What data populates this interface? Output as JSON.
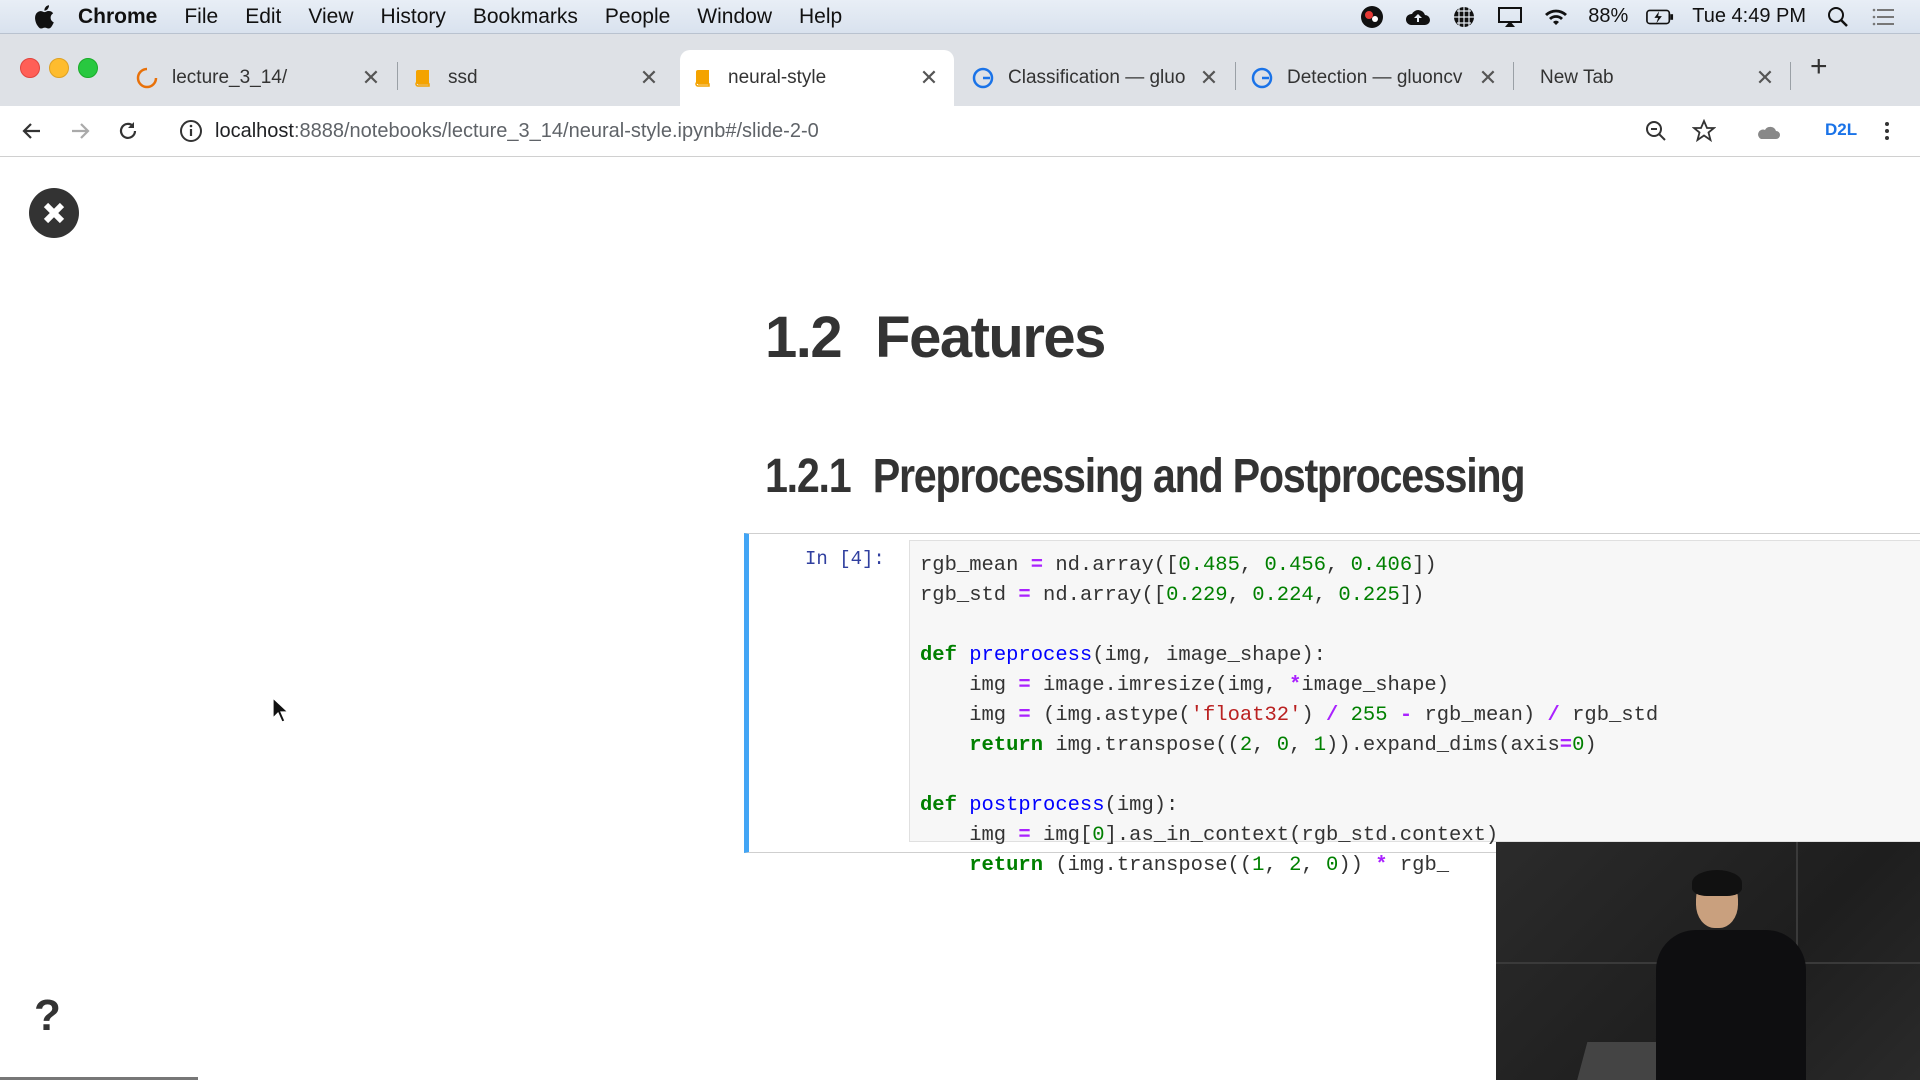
{
  "menubar": {
    "app_name": "Chrome",
    "items": [
      "File",
      "Edit",
      "View",
      "History",
      "Bookmarks",
      "People",
      "Window",
      "Help"
    ],
    "battery": "88%",
    "clock": "Tue 4:49 PM"
  },
  "tabs": [
    {
      "label": "lecture_3_14/",
      "icon": "loading-spinner-icon"
    },
    {
      "label": "ssd",
      "icon": "notebook-icon"
    },
    {
      "label": "neural-style",
      "icon": "notebook-icon",
      "active": true
    },
    {
      "label": "Classification — gluo",
      "icon": "gluon-g-icon"
    },
    {
      "label": "Detection — gluoncv",
      "icon": "gluon-g-icon"
    },
    {
      "label": "New Tab",
      "icon": ""
    }
  ],
  "toolbar": {
    "url_host": "localhost",
    "url_path": ":8888/notebooks/lecture_3_14/neural-style.ipynb#/slide-2-0",
    "extension_label": "D2L"
  },
  "notebook": {
    "heading1_number": "1.2",
    "heading1_text": "Features",
    "heading2_number": "1.2.1",
    "heading2_text": "Preprocessing and Postprocessing",
    "cell_prompt": "In [4]:",
    "code_lines": [
      "rgb_mean = nd.array([0.485, 0.456, 0.406])",
      "rgb_std = nd.array([0.229, 0.224, 0.225])",
      "",
      "def preprocess(img, image_shape):",
      "    img = image.imresize(img, *image_shape)",
      "    img = (img.astype('float32') / 255 - rgb_mean) / rgb_std",
      "    return img.transpose((2, 0, 1)).expand_dims(axis=0)",
      "",
      "def postprocess(img):",
      "    img = img[0].as_in_context(rgb_std.context)",
      "    return (img.transpose((1, 2, 0)) * rgb_"
    ],
    "help_label": "?"
  },
  "colors": {
    "cell_accent": "#42a5f5",
    "keyword": "#008000",
    "function_name": "#0000ff",
    "string": "#ba2121",
    "operator": "#aa22ff"
  }
}
